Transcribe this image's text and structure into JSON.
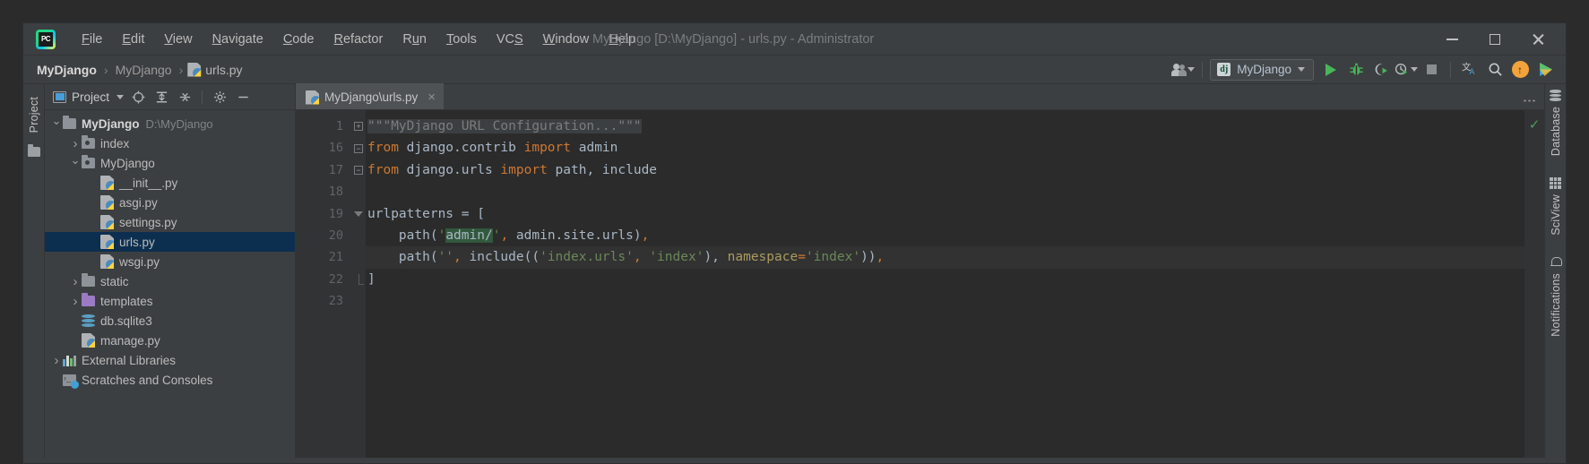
{
  "window": {
    "title": "MyDjango [D:\\MyDjango] - urls.py - Administrator",
    "minimize_label": "Minimize",
    "maximize_label": "Maximize",
    "close_label": "Close"
  },
  "menu": {
    "items": [
      {
        "pre": "",
        "mn": "F",
        "post": "ile"
      },
      {
        "pre": "",
        "mn": "E",
        "post": "dit"
      },
      {
        "pre": "",
        "mn": "V",
        "post": "iew"
      },
      {
        "pre": "",
        "mn": "N",
        "post": "avigate"
      },
      {
        "pre": "",
        "mn": "C",
        "post": "ode"
      },
      {
        "pre": "",
        "mn": "R",
        "post": "efactor"
      },
      {
        "pre": "R",
        "mn": "u",
        "post": "n"
      },
      {
        "pre": "",
        "mn": "T",
        "post": "ools"
      },
      {
        "pre": "VC",
        "mn": "S",
        "post": ""
      },
      {
        "pre": "",
        "mn": "W",
        "post": "indow"
      },
      {
        "pre": "",
        "mn": "H",
        "post": "elp"
      }
    ]
  },
  "breadcrumb": {
    "root": "MyDjango",
    "sep": "›",
    "mid": "MyDjango",
    "file": "urls.py"
  },
  "toolbar": {
    "run_config": "MyDjango",
    "run_config_icon_text": "dj",
    "run_label": "Run",
    "debug_label": "Debug",
    "coverage_label": "Run with Coverage",
    "profile_label": "Profile",
    "stop_label": "Stop",
    "translate_label": "Translate",
    "search_label": "Search Everywhere",
    "update_label": "Update Project",
    "colorful_label": "Run Anything"
  },
  "project_panel": {
    "tab_label": "Project",
    "header_title": "Project",
    "tree": [
      {
        "indent": 0,
        "arrow": "down",
        "icon": "folder",
        "label": "MyDjango",
        "bold": true,
        "path": "D:\\MyDjango",
        "selected": false
      },
      {
        "indent": 1,
        "arrow": "right",
        "icon": "package",
        "label": "index",
        "bold": false,
        "path": "",
        "selected": false
      },
      {
        "indent": 1,
        "arrow": "down",
        "icon": "package",
        "label": "MyDjango",
        "bold": false,
        "path": "",
        "selected": false
      },
      {
        "indent": 2,
        "arrow": "none",
        "icon": "python",
        "label": "__init__.py",
        "bold": false,
        "path": "",
        "selected": false
      },
      {
        "indent": 2,
        "arrow": "none",
        "icon": "python",
        "label": "asgi.py",
        "bold": false,
        "path": "",
        "selected": false
      },
      {
        "indent": 2,
        "arrow": "none",
        "icon": "python",
        "label": "settings.py",
        "bold": false,
        "path": "",
        "selected": false
      },
      {
        "indent": 2,
        "arrow": "none",
        "icon": "python",
        "label": "urls.py",
        "bold": false,
        "path": "",
        "selected": true
      },
      {
        "indent": 2,
        "arrow": "none",
        "icon": "python",
        "label": "wsgi.py",
        "bold": false,
        "path": "",
        "selected": false
      },
      {
        "indent": 1,
        "arrow": "right",
        "icon": "folder",
        "label": "static",
        "bold": false,
        "path": "",
        "selected": false
      },
      {
        "indent": 1,
        "arrow": "right",
        "icon": "purple",
        "label": "templates",
        "bold": false,
        "path": "",
        "selected": false
      },
      {
        "indent": 1,
        "arrow": "none",
        "icon": "db",
        "label": "db.sqlite3",
        "bold": false,
        "path": "",
        "selected": false
      },
      {
        "indent": 1,
        "arrow": "none",
        "icon": "python",
        "label": "manage.py",
        "bold": false,
        "path": "",
        "selected": false
      },
      {
        "indent": 0,
        "arrow": "right",
        "icon": "lib",
        "label": "External Libraries",
        "bold": false,
        "path": "",
        "selected": false
      },
      {
        "indent": 0,
        "arrow": "none",
        "icon": "scratch",
        "label": "Scratches and Consoles",
        "bold": false,
        "path": "",
        "selected": false
      }
    ]
  },
  "editor": {
    "tab_label": "MyDjango\\urls.py",
    "close_label": "×",
    "options_label": "⋮",
    "inspection_status": "✓",
    "lines": [
      {
        "num": "1",
        "fold": "plus",
        "current": false,
        "tokens": [
          {
            "t": "fold",
            "v": "\"\"\"MyDjango URL Configuration...\"\"\""
          }
        ]
      },
      {
        "num": "16",
        "fold": "minus",
        "current": false,
        "tokens": [
          {
            "t": "kw",
            "v": "from"
          },
          {
            "t": "pl",
            "v": " django.contrib "
          },
          {
            "t": "kw",
            "v": "import"
          },
          {
            "t": "pl",
            "v": " admin"
          }
        ]
      },
      {
        "num": "17",
        "fold": "minus-end",
        "current": false,
        "tokens": [
          {
            "t": "kw",
            "v": "from"
          },
          {
            "t": "pl",
            "v": " django.urls "
          },
          {
            "t": "kw",
            "v": "import"
          },
          {
            "t": "pl",
            "v": " path, include"
          }
        ]
      },
      {
        "num": "18",
        "fold": "none",
        "current": false,
        "tokens": []
      },
      {
        "num": "19",
        "fold": "tri",
        "current": false,
        "tokens": [
          {
            "t": "pl",
            "v": "urlpatterns = ["
          }
        ]
      },
      {
        "num": "20",
        "fold": "none",
        "current": false,
        "tokens": [
          {
            "t": "pl",
            "v": "    path("
          },
          {
            "t": "str",
            "v": "'"
          },
          {
            "t": "hl",
            "v": "admin/"
          },
          {
            "t": "str",
            "v": "'"
          },
          {
            "t": "kw",
            "v": ","
          },
          {
            "t": "pl",
            "v": " admin.site.urls)"
          },
          {
            "t": "kw",
            "v": ","
          }
        ]
      },
      {
        "num": "21",
        "fold": "none",
        "current": true,
        "tokens": [
          {
            "t": "pl",
            "v": "    path("
          },
          {
            "t": "str",
            "v": "''"
          },
          {
            "t": "kw",
            "v": ","
          },
          {
            "t": "pl",
            "v": " include(("
          },
          {
            "t": "str",
            "v": "'index.urls'"
          },
          {
            "t": "kw",
            "v": ","
          },
          {
            "t": "str",
            "v": " 'index'"
          },
          {
            "t": "pl",
            "v": "), "
          },
          {
            "t": "kwarg",
            "v": "namespace"
          },
          {
            "t": "kw",
            "v": "="
          },
          {
            "t": "str",
            "v": "'index'"
          },
          {
            "t": "pl",
            "v": "))"
          },
          {
            "t": "kw",
            "v": ","
          }
        ]
      },
      {
        "num": "22",
        "fold": "tri-end",
        "current": false,
        "tokens": [
          {
            "t": "pl",
            "v": "]"
          }
        ]
      },
      {
        "num": "23",
        "fold": "none",
        "current": false,
        "tokens": []
      }
    ]
  },
  "right_strip": {
    "items": [
      {
        "label": "Database",
        "icon": "database-icon"
      },
      {
        "label": "SciView",
        "icon": "grid-icon"
      },
      {
        "label": "Notifications",
        "icon": "bell-icon"
      }
    ]
  },
  "colors": {
    "accent_green": "#49b55b",
    "selection_blue": "#0d2f4f",
    "keyword_orange": "#cc7832",
    "string_green": "#6a8759",
    "highlight_green": "#32593d",
    "panel_bg": "#3c3f41",
    "editor_bg": "#2b2b2b"
  }
}
